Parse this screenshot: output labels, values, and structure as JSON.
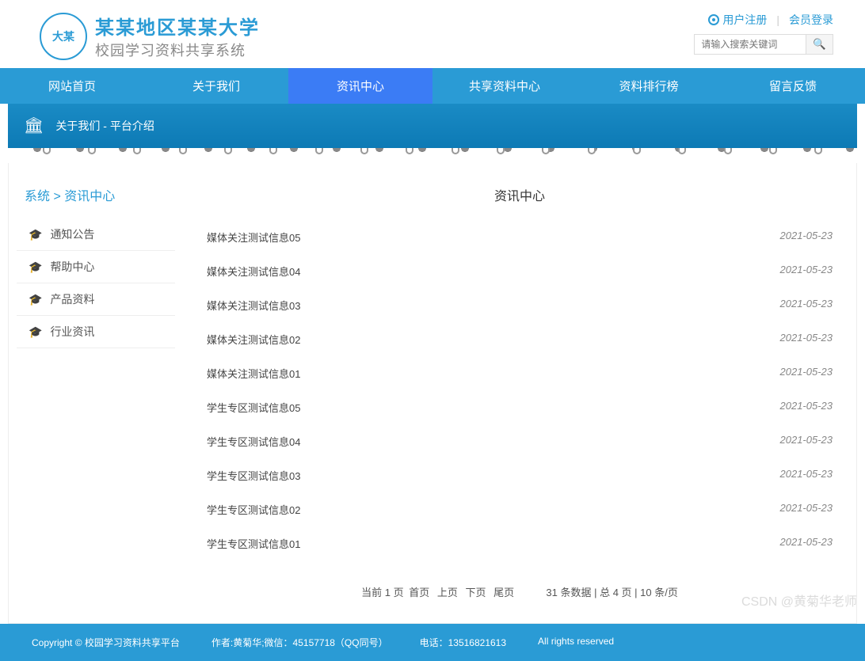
{
  "header": {
    "main_title": "某某地区某某大学",
    "sub_title": "校园学习资料共享系统",
    "register": "用户注册",
    "login": "会员登录",
    "search_placeholder": "请输入搜索关键词"
  },
  "nav": {
    "items": [
      "网站首页",
      "关于我们",
      "资讯中心",
      "共享资料中心",
      "资料排行榜",
      "留言反馈"
    ]
  },
  "page_header": "关于我们 - 平台介绍",
  "breadcrumb": "系统 > 资讯中心",
  "sidebar": {
    "items": [
      "通知公告",
      "帮助中心",
      "产品资料",
      "行业资讯"
    ]
  },
  "main": {
    "title": "资讯中心",
    "news": [
      {
        "title": "媒体关注测试信息05",
        "date": "2021-05-23"
      },
      {
        "title": "媒体关注测试信息04",
        "date": "2021-05-23"
      },
      {
        "title": "媒体关注测试信息03",
        "date": "2021-05-23"
      },
      {
        "title": "媒体关注测试信息02",
        "date": "2021-05-23"
      },
      {
        "title": "媒体关注测试信息01",
        "date": "2021-05-23"
      },
      {
        "title": "学生专区测试信息05",
        "date": "2021-05-23"
      },
      {
        "title": "学生专区测试信息04",
        "date": "2021-05-23"
      },
      {
        "title": "学生专区测试信息03",
        "date": "2021-05-23"
      },
      {
        "title": "学生专区测试信息02",
        "date": "2021-05-23"
      },
      {
        "title": "学生专区测试信息01",
        "date": "2021-05-23"
      }
    ]
  },
  "pagination": {
    "current": "当前 1 页",
    "first": "首页",
    "prev": "上页",
    "next": "下页",
    "last": "尾页",
    "stats": "31 条数据 | 总 4 页 | 10 条/页"
  },
  "footer": {
    "copyright": "Copyright © 校园学习资料共享平台",
    "author": "作者:黄菊华;微信：45157718（QQ同号）",
    "phone": "电话：13516821613",
    "rights": "All rights reserved"
  },
  "watermark": "CSDN @黄菊华老师"
}
